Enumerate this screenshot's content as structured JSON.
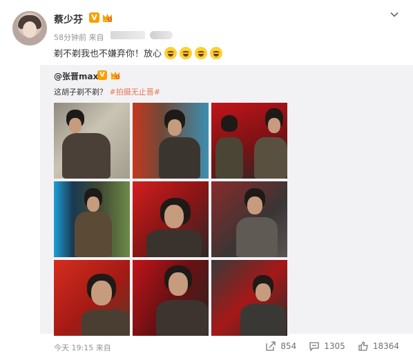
{
  "post": {
    "author": "蔡少芬",
    "verified_badge": "V",
    "time": "58分钟前",
    "source_label": "来自",
    "text": "剃不剃我也不嫌弃你！放心",
    "emoji": [
      "laugh-cry-emoji",
      "laugh-cry-emoji",
      "laugh-cry-emoji",
      "laugh-cry-emoji"
    ]
  },
  "repost": {
    "author": "@张晋max",
    "verified_badge": "V",
    "text": "这胡子剃不剃？",
    "hashtag": "#拍摄无止晋#",
    "photos": [
      "photo-1",
      "photo-2",
      "photo-3",
      "photo-4",
      "photo-5",
      "photo-6",
      "photo-7",
      "photo-8",
      "photo-9"
    ],
    "footer_time": "今天 19:15 来自",
    "repost_count": "854",
    "comment_count": "1305",
    "like_count": "18364"
  },
  "colors": {
    "badge": "#f7a100",
    "hashtag": "#eb7350",
    "repost_bg": "#f2f2f5"
  }
}
